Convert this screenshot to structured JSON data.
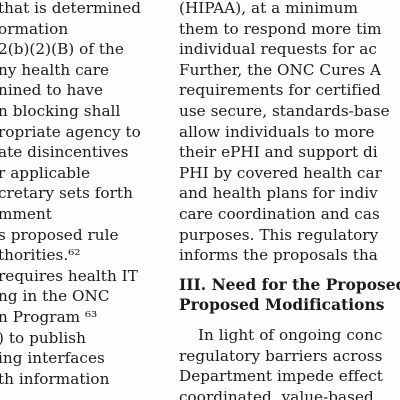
{
  "left_column": {
    "lines": [
      "that is determined",
      "ormation",
      "2(b)(2)(B) of the",
      "ny health care",
      "nined to have",
      "n blocking shall",
      "ropriate agency to",
      "ate disincentives",
      "r applicable",
      "cretary sets forth",
      "mment",
      "s proposed rule",
      "thorities.⁶²",
      "requires health IT",
      "ng in the ONC",
      "n Program ⁶³",
      ") to publish",
      "ing interfaces",
      "th information",
      "..."
    ]
  },
  "right_column": {
    "lines_top": [
      "(HIPAA), at a minimum",
      "them to respond more tim",
      "individual requests for ac",
      "Further, the ONC Cures A",
      "requirements for certified",
      "use secure, standards-base",
      "allow individuals to more",
      "their ePHI and support di",
      "PHI by covered health car",
      "and health plans for indiv",
      "care coordination and cas",
      "purposes. This regulatory",
      "informs the proposals tha"
    ],
    "heading_lines": [
      "III. Need for the Proposed",
      "Proposed Modifications"
    ],
    "paragraph_lines": [
      "In light of ongoing conc",
      "regulatory barriers across",
      "Department impede effect",
      "coordinated, value-based"
    ]
  }
}
